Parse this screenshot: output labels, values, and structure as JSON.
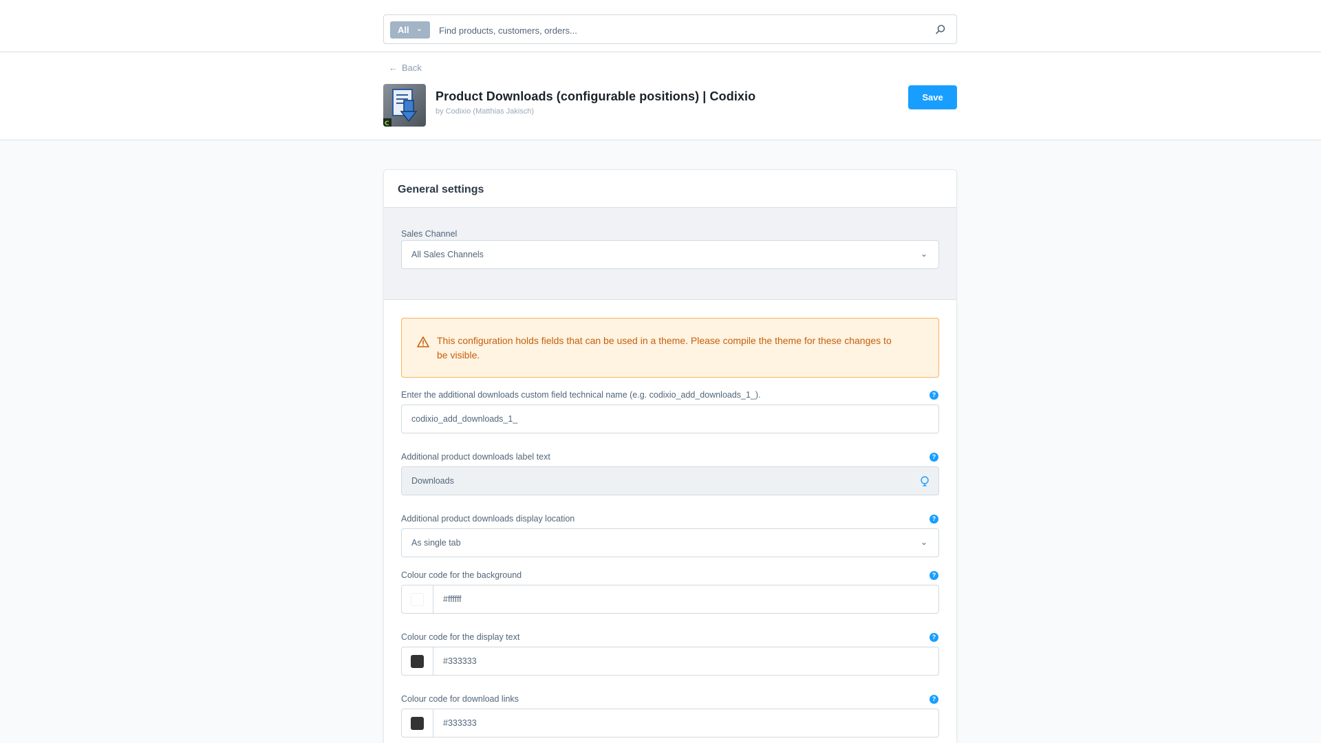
{
  "search": {
    "type_label": "All",
    "placeholder": "Find products, customers, orders..."
  },
  "header": {
    "back_label": "Back",
    "title": "Product Downloads (configurable positions) | Codixio",
    "subtitle": "by Codixio (Matthias Jakisch)",
    "save_label": "Save"
  },
  "card": {
    "title": "General settings",
    "sales_channel": {
      "label": "Sales Channel",
      "value": "All Sales Channels"
    },
    "alert": {
      "text": "This configuration holds fields that can be used in a theme. Please compile the theme for these changes to be visible."
    },
    "fields": {
      "technical_name": {
        "label": "Enter the additional downloads custom field technical name (e.g. codixio_add_downloads_1_).",
        "value": "codixio_add_downloads_1_"
      },
      "label_text": {
        "label": "Additional product downloads label text",
        "value": "Downloads"
      },
      "display_location": {
        "label": "Additional product downloads display location",
        "value": "As single tab"
      },
      "background_colour": {
        "label": "Colour code for the background",
        "value": "#ffffff",
        "swatch": "#ffffff"
      },
      "text_colour": {
        "label": "Colour code for the display text",
        "value": "#333333",
        "swatch": "#333333"
      },
      "link_colour": {
        "label": "Colour code for download links",
        "value": "#333333",
        "swatch": "#333333"
      }
    }
  },
  "colors": {
    "accent": "#189eff",
    "warning_text": "#c65f0c",
    "warning_bg": "#fff3e1"
  }
}
